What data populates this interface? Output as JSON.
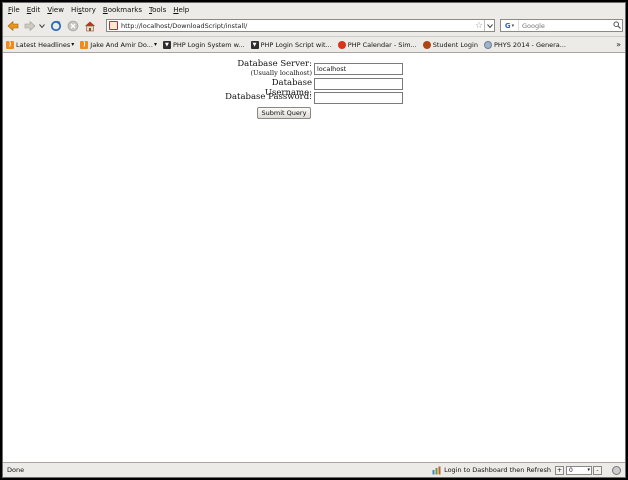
{
  "menus": [
    {
      "key": "F",
      "rest": "ile"
    },
    {
      "key": "E",
      "rest": "dit"
    },
    {
      "key": "V",
      "rest": "iew"
    },
    {
      "pre": "Hi",
      "key": "s",
      "rest": "tory"
    },
    {
      "key": "B",
      "rest": "ookmarks"
    },
    {
      "key": "T",
      "rest": "ools"
    },
    {
      "key": "H",
      "rest": "elp"
    }
  ],
  "nav": {
    "url": "http://localhost/DownloadScript/install/",
    "search_placeholder": "Google",
    "search_engine_icon": "google-g-icon"
  },
  "bookmarks": [
    {
      "label": "Latest Headlines",
      "icon": "rss",
      "caret": "▾"
    },
    {
      "label": "Jake And Amir Do...",
      "icon": "rss",
      "caret": "▾"
    },
    {
      "label": "PHP Login System w...",
      "icon": "pm",
      "caret": ""
    },
    {
      "label": "PHP Login Script wit...",
      "icon": "pm",
      "caret": ""
    },
    {
      "label": "PHP Calendar - Sim...",
      "icon": "ball",
      "caret": ""
    },
    {
      "label": "Student Login",
      "icon": "ballb",
      "caret": ""
    },
    {
      "label": "PHYS 2014 - Genera...",
      "icon": "globe",
      "caret": ""
    }
  ],
  "bookmarks_overflow": "»",
  "form": {
    "server_label": "Database Server:",
    "server_sublabel": "(Usually localhost)",
    "server_value": "localhost",
    "username_label": "Database Username:",
    "username_value": "",
    "password_label": "Database Password:",
    "password_value": "",
    "submit_label": "Submit Query"
  },
  "status": {
    "text": "Done",
    "link": "Login to Dashboard then Refresh",
    "plus": "+",
    "minus": "-",
    "stepper_value": "0"
  }
}
